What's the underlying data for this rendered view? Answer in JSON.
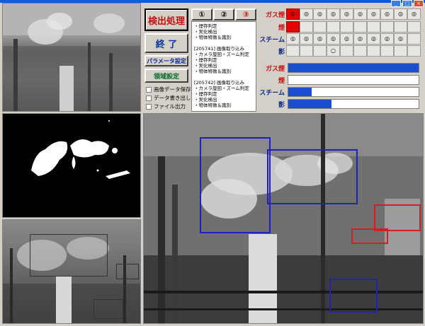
{
  "window": {
    "min": "_",
    "max": "□",
    "close": "×"
  },
  "buttons": {
    "detect": "検出処理",
    "end": "終 了",
    "param": "パラメータ設定",
    "region": "領域設定"
  },
  "checkboxes": [
    {
      "label": "画像データ保存"
    },
    {
      "label": "データ書き出し"
    },
    {
      "label": "ファイル出力"
    }
  ],
  "tabs": [
    "①",
    "②",
    "③"
  ],
  "log_text": "・煙存判定\n・実化検出\n・物体特徴＆識別\n\n[205741] 画像取り込み\n・カメラ旋回・ズーム判定\n・煙存判定\n・実化検出\n・物体特徴＆識別\n\n[205742] 画像取り込み\n・カメラ旋回・ズーム判定\n・煙存判定\n・実化検出\n・物体特徴＆識別",
  "grid": {
    "rows": [
      {
        "label": "ガス煙",
        "color": "red",
        "cells": [
          "◎",
          "◎",
          "◎",
          "◎",
          "◎",
          "◎",
          "◎",
          "◎",
          "◎",
          "◎"
        ],
        "highlight": [
          0
        ]
      },
      {
        "label": "煙",
        "color": "red",
        "cells": [
          "",
          "",
          "",
          "",
          "",
          "",
          "",
          "",
          "",
          ""
        ],
        "highlight": [
          0
        ]
      },
      {
        "label": "スチーム",
        "color": "blue",
        "cells": [
          "◎",
          "◎",
          "◎",
          "◎",
          "◎",
          "◎",
          "◎",
          "◎",
          "◎",
          ""
        ],
        "highlight": []
      },
      {
        "label": "影",
        "color": "blue",
        "cells": [
          "",
          "",
          "",
          "○",
          "",
          "",
          "",
          "",
          "",
          ""
        ],
        "highlight": []
      }
    ]
  },
  "bars": [
    {
      "label": "ガス煙",
      "color": "red",
      "level": 1.0
    },
    {
      "label": "煙",
      "color": "red",
      "level": 0.0
    },
    {
      "label": "スチーム",
      "color": "blue",
      "level": 0.18
    },
    {
      "label": "影",
      "color": "blue",
      "level": 0.33
    }
  ],
  "colors": {
    "accent_red": "#c81010",
    "accent_blue": "#1a4fd0",
    "roi_blue": "#2020c0",
    "roi_red": "#d02020"
  }
}
